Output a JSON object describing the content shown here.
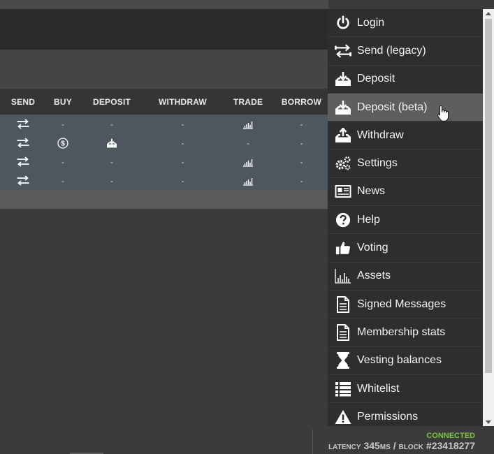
{
  "table": {
    "headers": [
      "SEND",
      "BUY",
      "DEPOSIT",
      "WITHDRAW",
      "TRADE",
      "BORROW"
    ],
    "rows": [
      {
        "send": "send-icon",
        "buy": "-",
        "deposit": "-",
        "withdraw": "-",
        "trade": "trade-icon",
        "borrow": "-"
      },
      {
        "send": "send-icon",
        "buy": "buy-icon",
        "deposit": "deposit-icon",
        "withdraw": "-",
        "trade": "-",
        "borrow": "-"
      },
      {
        "send": "send-icon",
        "buy": "-",
        "deposit": "-",
        "withdraw": "-",
        "trade": "trade-icon",
        "borrow": "-"
      },
      {
        "send": "send-icon",
        "buy": "-",
        "deposit": "-",
        "withdraw": "-",
        "trade": "trade-icon",
        "borrow": "-"
      }
    ]
  },
  "menu": {
    "items": [
      {
        "label": "Login",
        "icon": "power-icon"
      },
      {
        "label": "Send (legacy)",
        "icon": "transfer-icon"
      },
      {
        "label": "Deposit",
        "icon": "deposit-icon"
      },
      {
        "label": "Deposit (beta)",
        "icon": "deposit-icon",
        "active": true
      },
      {
        "label": "Withdraw",
        "icon": "withdraw-icon"
      },
      {
        "label": "Settings",
        "icon": "gears-icon"
      },
      {
        "label": "News",
        "icon": "newspaper-icon"
      },
      {
        "label": "Help",
        "icon": "question-icon"
      },
      {
        "label": "Voting",
        "icon": "thumbs-up-icon"
      },
      {
        "label": "Assets",
        "icon": "bar-chart-icon"
      },
      {
        "label": "Signed Messages",
        "icon": "document-icon"
      },
      {
        "label": "Membership stats",
        "icon": "document-icon"
      },
      {
        "label": "Vesting balances",
        "icon": "hourglass-icon"
      },
      {
        "label": "Whitelist",
        "icon": "list-icon"
      },
      {
        "label": "Permissions",
        "icon": "warning-icon"
      }
    ]
  },
  "status": {
    "connected": "CONNECTED",
    "latency_label": "LATENCY",
    "latency_value": "345",
    "latency_unit": "MS",
    "separator": "/",
    "block_label": "BLOCK",
    "block_value": "#23418277"
  },
  "colors": {
    "connected": "#7cc342",
    "menu_bg": "#2e2e2e",
    "menu_active": "#5e5e5e",
    "table_body": "#4e5660"
  }
}
